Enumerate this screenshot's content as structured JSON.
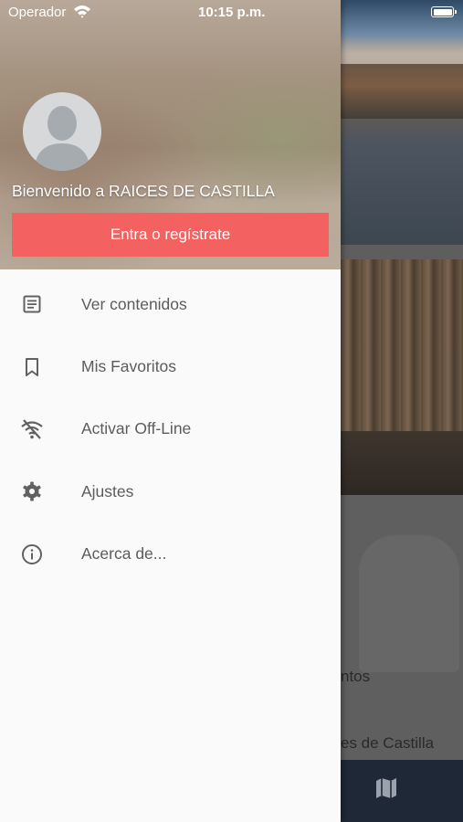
{
  "status_bar": {
    "carrier": "Operador",
    "time": "10:15 p.m."
  },
  "drawer": {
    "welcome_text": "Bienvenido a RAICES DE CASTILLA",
    "login_button_label": "Entra o regístrate",
    "login_button_color": "#f46161",
    "menu_items": [
      {
        "label": "Ver contenidos",
        "icon": "document-icon"
      },
      {
        "label": "Mis Favoritos",
        "icon": "bookmark-icon"
      },
      {
        "label": "Activar Off-Line",
        "icon": "wifi-off-icon"
      },
      {
        "label": "Ajustes",
        "icon": "gear-icon"
      },
      {
        "label": "Acerca de...",
        "icon": "info-icon"
      }
    ]
  },
  "background": {
    "partial_text_1": "ntos",
    "partial_text_2": "es de Castilla",
    "bottom_bar_icon": "map-icon",
    "bottom_bar_color": "#1e2836"
  }
}
